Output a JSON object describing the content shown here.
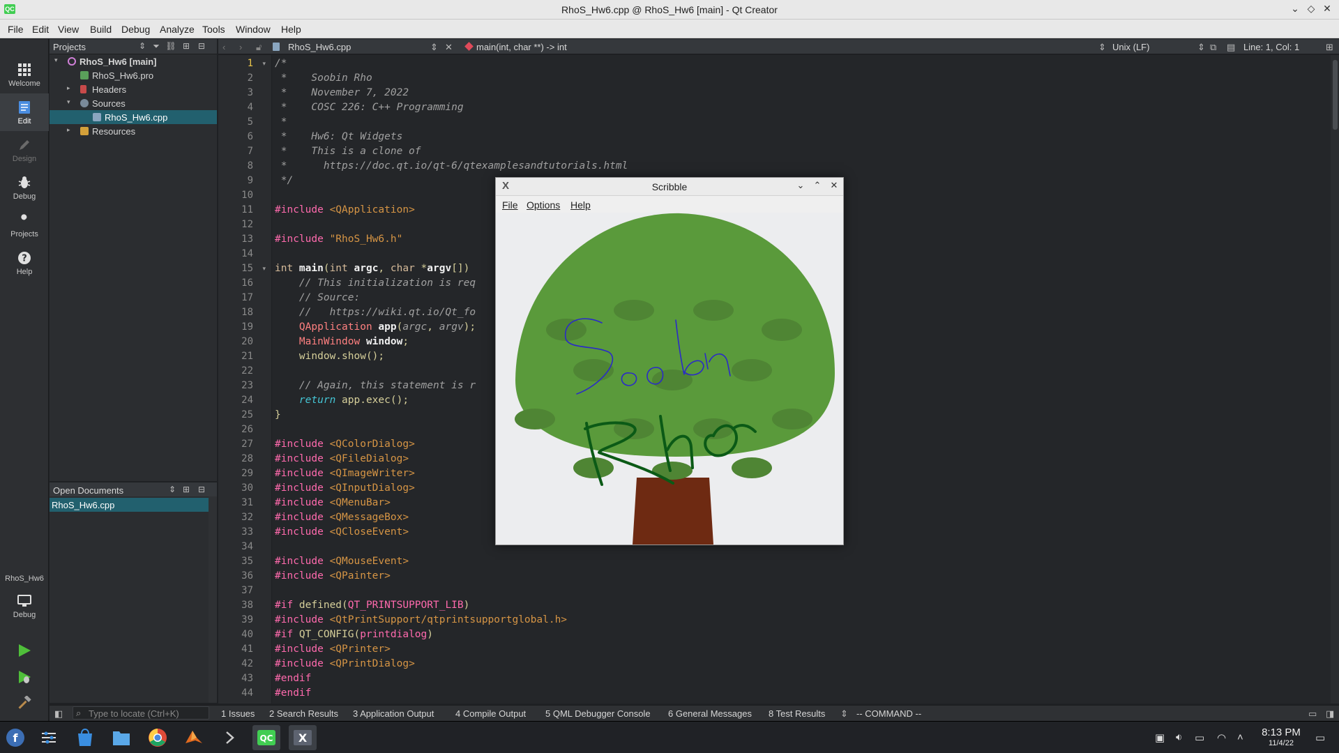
{
  "window": {
    "title": "RhoS_Hw6.cpp @ RhoS_Hw6 [main] - Qt Creator",
    "app_icon_text": "QC",
    "controls": [
      "⌄",
      "◇",
      "✕"
    ]
  },
  "menubar": [
    "File",
    "Edit",
    "View",
    "Build",
    "Debug",
    "Analyze",
    "Tools",
    "Window",
    "Help"
  ],
  "modes": [
    {
      "label": "Welcome",
      "icon": "grid-icon"
    },
    {
      "label": "Edit",
      "icon": "edit-icon"
    },
    {
      "label": "Design",
      "icon": "pen-icon"
    },
    {
      "label": "Debug",
      "icon": "bug-icon"
    },
    {
      "label": "Projects",
      "icon": "wrench-icon"
    },
    {
      "label": "Help",
      "icon": "help-icon"
    }
  ],
  "kit": {
    "project": "RhoS_Hw6",
    "mode": "Debug"
  },
  "projects_panel": {
    "title": "Projects",
    "tree": [
      {
        "label": "RhoS_Hw6 [main]",
        "level": 0,
        "arrow": "▾",
        "bold": true
      },
      {
        "label": "RhoS_Hw6.pro",
        "level": 1,
        "arrow": ""
      },
      {
        "label": "Headers",
        "level": 1,
        "arrow": "▸"
      },
      {
        "label": "Sources",
        "level": 1,
        "arrow": "▾"
      },
      {
        "label": "RhoS_Hw6.cpp",
        "level": 2,
        "arrow": "",
        "selected": true
      },
      {
        "label": "Resources",
        "level": 1,
        "arrow": "▸"
      }
    ]
  },
  "open_documents": {
    "title": "Open Documents",
    "items": [
      "RhoS_Hw6.cpp"
    ]
  },
  "editor": {
    "file": "RhoS_Hw6.cpp",
    "symbol": "main(int, char **) -> int",
    "line_ending": "Unix (LF)",
    "position": "Line: 1, Col: 1",
    "lines": [
      [
        [
          "cmt",
          "/*"
        ]
      ],
      [
        [
          "cmt",
          " *    Soobin Rho"
        ]
      ],
      [
        [
          "cmt",
          " *    November 7, 2022"
        ]
      ],
      [
        [
          "cmt",
          " *    COSC 226: C++ Programming"
        ]
      ],
      [
        [
          "cmt",
          " *"
        ]
      ],
      [
        [
          "cmt",
          " *    Hw6: Qt Widgets"
        ]
      ],
      [
        [
          "cmt",
          " *    This is a clone of"
        ]
      ],
      [
        [
          "cmt",
          " *      https://doc.qt.io/qt-6/qtexamplesandtutorials.html"
        ]
      ],
      [
        [
          "cmt",
          " */"
        ]
      ],
      [],
      [
        [
          "pre",
          "#include "
        ],
        [
          "inc",
          "<QApplication>"
        ]
      ],
      [],
      [
        [
          "pre",
          "#include "
        ],
        [
          "inc",
          "\"RhoS_Hw6.h\""
        ]
      ],
      [],
      [
        [
          "kw",
          "int "
        ],
        [
          "fn",
          "main"
        ],
        [
          "pl",
          "("
        ],
        [
          "kw",
          "int "
        ],
        [
          "fn",
          "argc"
        ],
        [
          "pl",
          ", "
        ],
        [
          "kw",
          "char "
        ],
        [
          "pl",
          "*"
        ],
        [
          "fn",
          "argv"
        ],
        [
          "pl",
          "[])"
        ]
      ],
      [
        [
          "cmt",
          "    // This initialization is req"
        ]
      ],
      [
        [
          "cmt",
          "    // Source:"
        ]
      ],
      [
        [
          "cmt",
          "    //   https://wiki.qt.io/Qt_fo"
        ]
      ],
      [
        [
          "ty",
          "    QApplication "
        ],
        [
          "fn",
          "app"
        ],
        [
          "pl",
          "("
        ],
        [
          "cmt",
          "argc"
        ],
        [
          "pl",
          ", "
        ],
        [
          "cmt",
          "argv"
        ],
        [
          "pl",
          ");"
        ]
      ],
      [
        [
          "ty",
          "    MainWindow "
        ],
        [
          "fn",
          "window"
        ],
        [
          "pl",
          ";"
        ]
      ],
      [
        [
          "pl",
          "    window.show();"
        ]
      ],
      [],
      [
        [
          "cmt",
          "    // Again, this statement is r"
        ]
      ],
      [
        [
          "ret",
          "    return "
        ],
        [
          "pl",
          "app.exec();"
        ]
      ],
      [
        [
          "pl",
          "}"
        ]
      ],
      [],
      [
        [
          "pre",
          "#include "
        ],
        [
          "inc",
          "<QColorDialog>"
        ]
      ],
      [
        [
          "pre",
          "#include "
        ],
        [
          "inc",
          "<QFileDialog>"
        ]
      ],
      [
        [
          "pre",
          "#include "
        ],
        [
          "inc",
          "<QImageWriter>"
        ]
      ],
      [
        [
          "pre",
          "#include "
        ],
        [
          "inc",
          "<QInputDialog>"
        ]
      ],
      [
        [
          "pre",
          "#include "
        ],
        [
          "inc",
          "<QMenuBar>"
        ]
      ],
      [
        [
          "pre",
          "#include "
        ],
        [
          "inc",
          "<QMessageBox>"
        ]
      ],
      [
        [
          "pre",
          "#include "
        ],
        [
          "inc",
          "<QCloseEvent>"
        ]
      ],
      [],
      [
        [
          "pre",
          "#include "
        ],
        [
          "inc",
          "<QMouseEvent>"
        ]
      ],
      [
        [
          "pre",
          "#include "
        ],
        [
          "inc",
          "<QPainter>"
        ]
      ],
      [],
      [
        [
          "pre",
          "#if "
        ],
        [
          "pl",
          "defined("
        ],
        [
          "pre",
          "QT_PRINTSUPPORT_LIB"
        ],
        [
          "pl",
          ")"
        ]
      ],
      [
        [
          "pre",
          "#include "
        ],
        [
          "inc",
          "<QtPrintSupport/qtprintsupportglobal.h>"
        ]
      ],
      [
        [
          "pre",
          "#if "
        ],
        [
          "pl",
          "QT_CONFIG("
        ],
        [
          "pre",
          "printdialog"
        ],
        [
          "pl",
          ")"
        ]
      ],
      [
        [
          "pre",
          "#include "
        ],
        [
          "inc",
          "<QPrinter>"
        ]
      ],
      [
        [
          "pre",
          "#include "
        ],
        [
          "inc",
          "<QPrintDialog>"
        ]
      ],
      [
        [
          "pre",
          "#endif"
        ]
      ],
      [
        [
          "pre",
          "#endif"
        ]
      ]
    ]
  },
  "output_bar": {
    "locate_placeholder": "Type to locate (Ctrl+K)",
    "tabs": [
      "1  Issues",
      "2  Search Results",
      "3  Application Output",
      "4  Compile Output",
      "5  QML Debugger Console",
      "6  General Messages",
      "8  Test Results"
    ],
    "mode": "-- COMMAND --"
  },
  "scribble": {
    "title": "Scribble",
    "menu": [
      "File",
      "Options",
      "Help"
    ],
    "colors": {
      "canopy": "#5a9a3b",
      "spots": "#4f8534",
      "trunk": "#6e2a12",
      "blue_ink": "#2a2ac8",
      "green_ink": "#0b5a16"
    }
  },
  "taskbar": {
    "time": "8:13 PM",
    "date": "11/4/22",
    "apps": [
      "fedora-icon",
      "settings-icon",
      "store-icon",
      "files-icon",
      "chrome-icon",
      "matlab-icon",
      "terminal-icon",
      "qtcreator-icon",
      "x11-icon"
    ]
  }
}
